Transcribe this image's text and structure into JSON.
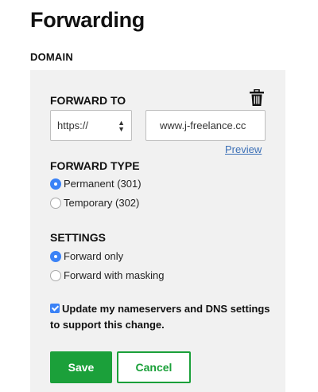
{
  "page": {
    "title": "Forwarding",
    "section_label": "DOMAIN"
  },
  "forward_to": {
    "label": "FORWARD TO",
    "protocol": "https://",
    "url_value": "www.j-freelance.cc",
    "preview_link": "Preview",
    "delete_icon": "trash-icon"
  },
  "forward_type": {
    "label": "FORWARD TYPE",
    "options": [
      {
        "label": "Permanent (301)",
        "selected": true
      },
      {
        "label": "Temporary (302)",
        "selected": false
      }
    ]
  },
  "settings": {
    "label": "SETTINGS",
    "options": [
      {
        "label": "Forward only",
        "selected": true
      },
      {
        "label": "Forward with masking",
        "selected": false
      }
    ],
    "nameserver_checkbox": {
      "checked": true,
      "label": "Update my nameservers and DNS settings to support this change."
    }
  },
  "actions": {
    "save_label": "Save",
    "cancel_label": "Cancel"
  },
  "colors": {
    "accent_green": "#1ba03a",
    "radio_blue": "#3b82f6",
    "link_blue": "#3b6fb6",
    "panel_bg": "#f1f1f1"
  }
}
